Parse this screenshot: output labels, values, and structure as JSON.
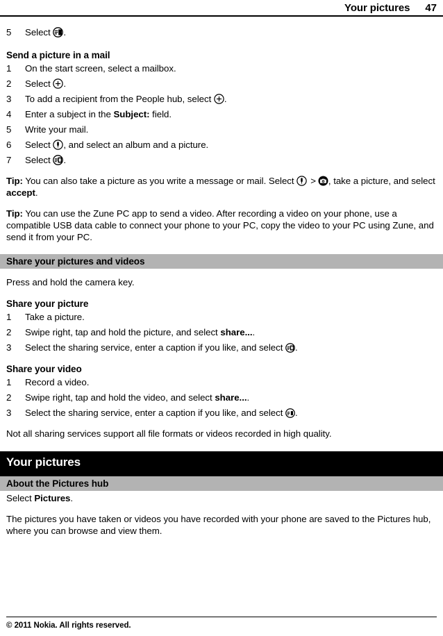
{
  "header": {
    "title": "Your pictures",
    "page_number": "47"
  },
  "steps_top": [
    {
      "num": "5",
      "text_before": "Select ",
      "icon": "send-icon",
      "text_after": "."
    }
  ],
  "sections": {
    "send_picture_mail": {
      "heading": "Send a picture in a mail",
      "steps": [
        {
          "num": "1",
          "text_before": "On the start screen, select a mailbox.",
          "icon": "",
          "text_after": ""
        },
        {
          "num": "2",
          "text_before": "Select ",
          "icon": "plus-circle-icon",
          "text_after": "."
        },
        {
          "num": "3",
          "text_before": "To add a recipient from the People hub, select ",
          "icon": "plus-circle-icon",
          "text_after": "."
        },
        {
          "num": "4",
          "text_before": "Enter a subject in the ",
          "bold": "Subject:",
          "icon": "",
          "text_after": " field."
        },
        {
          "num": "5",
          "text_before": "Write your mail.",
          "icon": "",
          "text_after": ""
        },
        {
          "num": "6",
          "text_before": "Select ",
          "icon": "attach-icon",
          "text_after": ", and select an album and a picture."
        },
        {
          "num": "7",
          "text_before": "Select ",
          "icon": "send-icon",
          "text_after": "."
        }
      ]
    },
    "tip_1": {
      "label": "Tip:",
      "text_before": " You can also take a picture as you write a message or mail. Select ",
      "icon_1": "attach-icon",
      "separator": ">",
      "icon_2": "camera-icon",
      "text_middle": ", take a picture, and select ",
      "bold": "accept",
      "text_after": "."
    },
    "tip_2": {
      "label": "Tip:",
      "text": " You can use the Zune PC app to send a video. After recording a video on your phone, use a compatible USB data cable to connect your phone to your PC, copy the video to your PC using Zune, and send it from your PC."
    },
    "share_band": {
      "title": "Share your pictures and videos",
      "intro": "Press and hold the camera key."
    },
    "share_picture": {
      "heading": "Share your picture",
      "steps": [
        {
          "num": "1",
          "text_before": "Take a picture.",
          "icon": "",
          "text_after": ""
        },
        {
          "num": "2",
          "text_before": "Swipe right, tap and hold the picture, and select ",
          "bold": "share...",
          "icon": "",
          "text_after": "."
        },
        {
          "num": "3",
          "text_before": "Select the sharing service, enter a caption if you like, and select ",
          "icon": "send-icon",
          "text_after": "."
        }
      ]
    },
    "share_video": {
      "heading": "Share your video",
      "steps": [
        {
          "num": "1",
          "text_before": "Record a video.",
          "icon": "",
          "text_after": ""
        },
        {
          "num": "2",
          "text_before": "Swipe right, tap and hold the video, and select ",
          "bold": "share...",
          "icon": "",
          "text_after": "."
        },
        {
          "num": "3",
          "text_before": "Select the sharing service, enter a caption if you like, and select ",
          "icon": "send-icon",
          "text_after": "."
        }
      ]
    },
    "note": "Not all sharing services support all file formats or videos recorded in high quality.",
    "chapter": {
      "title": "Your pictures"
    },
    "about_pictures_hub": {
      "band_title": "About the Pictures hub",
      "select_line_before": "Select ",
      "select_line_bold": "Pictures",
      "select_line_after": ".",
      "body": "The pictures you have taken or videos you have recorded with your phone are saved to the Pictures hub, where you can browse and view them."
    }
  },
  "footer": {
    "copyright": "© 2011 Nokia. All rights reserved."
  },
  "colors": {
    "band_gray": "#b3b3b3",
    "chapter_black": "#000000",
    "text": "#000000",
    "page_background": "#ffffff"
  }
}
